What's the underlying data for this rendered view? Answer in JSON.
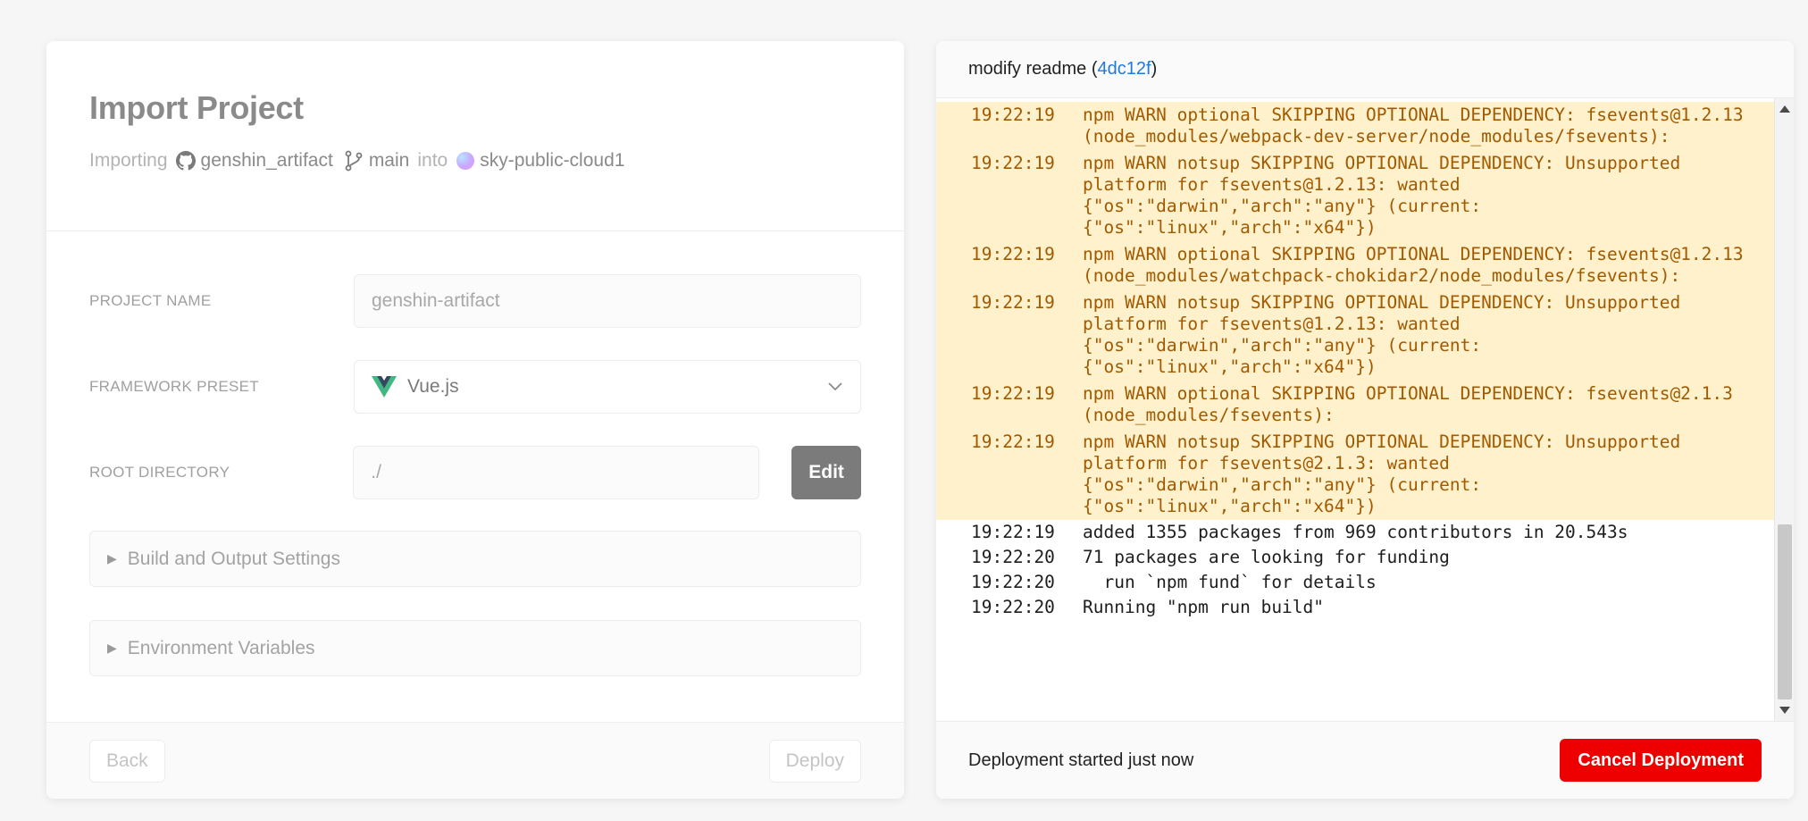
{
  "import_panel": {
    "title": "Import Project",
    "importing_label": "Importing",
    "repo_name": "genshin_artifact",
    "branch_name": "main",
    "into_label": "into",
    "org_name": "sky-public-cloud1",
    "project_name_label": "PROJECT NAME",
    "project_name_value": "genshin-artifact",
    "framework_label": "FRAMEWORK PRESET",
    "framework_value": "Vue.js",
    "root_dir_label": "ROOT DIRECTORY",
    "root_dir_value": "./",
    "edit_label": "Edit",
    "build_settings_label": "Build and Output Settings",
    "env_vars_label": "Environment Variables",
    "back_label": "Back",
    "deploy_label": "Deploy"
  },
  "deploy_panel": {
    "commit_message": "modify readme",
    "commit_hash": "4dc12f",
    "status_text": "Deployment started just now",
    "cancel_label": "Cancel Deployment",
    "logs": [
      {
        "time": "19:22:19",
        "level": "warn",
        "text": "npm WARN optional SKIPPING OPTIONAL DEPENDENCY: fsevents@1.2.13 (node_modules/webpack-dev-server/node_modules/fsevents):"
      },
      {
        "time": "19:22:19",
        "level": "warn",
        "text": "npm WARN notsup SKIPPING OPTIONAL DEPENDENCY: Unsupported platform for fsevents@1.2.13: wanted {\"os\":\"darwin\",\"arch\":\"any\"} (current: {\"os\":\"linux\",\"arch\":\"x64\"})"
      },
      {
        "time": "19:22:19",
        "level": "warn",
        "text": "npm WARN optional SKIPPING OPTIONAL DEPENDENCY: fsevents@1.2.13 (node_modules/watchpack-chokidar2/node_modules/fsevents):"
      },
      {
        "time": "19:22:19",
        "level": "warn",
        "text": "npm WARN notsup SKIPPING OPTIONAL DEPENDENCY: Unsupported platform for fsevents@1.2.13: wanted {\"os\":\"darwin\",\"arch\":\"any\"} (current: {\"os\":\"linux\",\"arch\":\"x64\"})"
      },
      {
        "time": "19:22:19",
        "level": "warn",
        "text": "npm WARN optional SKIPPING OPTIONAL DEPENDENCY: fsevents@2.1.3 (node_modules/fsevents):"
      },
      {
        "time": "19:22:19",
        "level": "warn",
        "text": "npm WARN notsup SKIPPING OPTIONAL DEPENDENCY: Unsupported platform for fsevents@2.1.3: wanted {\"os\":\"darwin\",\"arch\":\"any\"} (current: {\"os\":\"linux\",\"arch\":\"x64\"})"
      },
      {
        "time": "19:22:19",
        "level": "info",
        "text": "added 1355 packages from 969 contributors in 20.543s"
      },
      {
        "time": "19:22:20",
        "level": "info",
        "text": "71 packages are looking for funding"
      },
      {
        "time": "19:22:20",
        "level": "info",
        "text": "  run `npm fund` for details"
      },
      {
        "time": "19:22:20",
        "level": "info",
        "text": "Running \"npm run build\""
      }
    ]
  },
  "icons": {
    "repo": "github-icon",
    "branch": "git-branch-icon",
    "framework": "vue-logo-icon",
    "dropdown": "chevron-down-icon",
    "collapse": "triangle-right-icon"
  },
  "colors": {
    "warn_bg": "#fff1cc",
    "warn_text": "#a25a00",
    "cancel_button": "#ee0000",
    "commit_link": "#1f7ae0",
    "edit_button": "#7b7b7b"
  }
}
